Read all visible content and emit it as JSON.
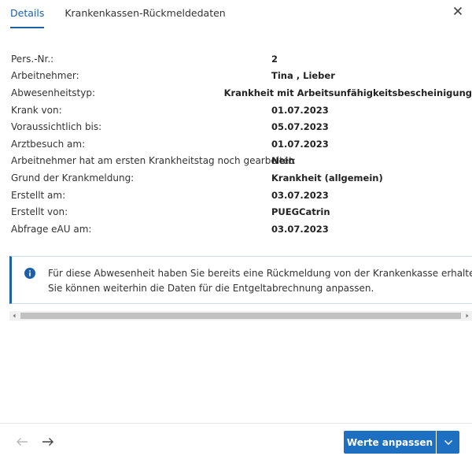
{
  "tabs": [
    {
      "label": "Details",
      "active": true
    },
    {
      "label": "Krankenkassen-Rückmeldedaten",
      "active": false
    }
  ],
  "close_icon": "close-icon",
  "details": [
    {
      "label": "Pers.-Nr.:",
      "value": "2"
    },
    {
      "label": "Arbeitnehmer:",
      "value": "Tina , Lieber"
    },
    {
      "label": "Abwesenheitstyp:",
      "value": "Krankheit mit Arbeitsunfähigkeitsbescheinigung"
    },
    {
      "label": "Krank von:",
      "value": "01.07.2023"
    },
    {
      "label": "Voraussichtlich bis:",
      "value": "05.07.2023"
    },
    {
      "label": "Arztbesuch am:",
      "value": "01.07.2023"
    },
    {
      "label": "Arbeitnehmer hat am ersten Krankheitstag noch gearbeitet:",
      "value": "Nein"
    },
    {
      "label": "Grund der Krankmeldung:",
      "value": "Krankheit (allgemein)"
    },
    {
      "label": "Erstellt am:",
      "value": "03.07.2023"
    },
    {
      "label": "Erstellt von:",
      "value": "PUEGCatrin"
    },
    {
      "label": "Abfrage eAU am:",
      "value": "03.07.2023"
    }
  ],
  "info": {
    "icon": "info-icon",
    "text": "Für diese Abwesenheit haben Sie bereits eine Rückmeldung von der Krankenkasse erhalten. Sie können weiterhin die Daten für die Entgeltabrechnung anpassen."
  },
  "footer": {
    "prev_icon": "arrow-left-icon",
    "next_icon": "arrow-right-icon",
    "primary_label": "Werte anpassen",
    "split_icon": "chevron-down-icon"
  },
  "colors": {
    "accent": "#1d5fa8",
    "button": "#1d6fc1"
  }
}
